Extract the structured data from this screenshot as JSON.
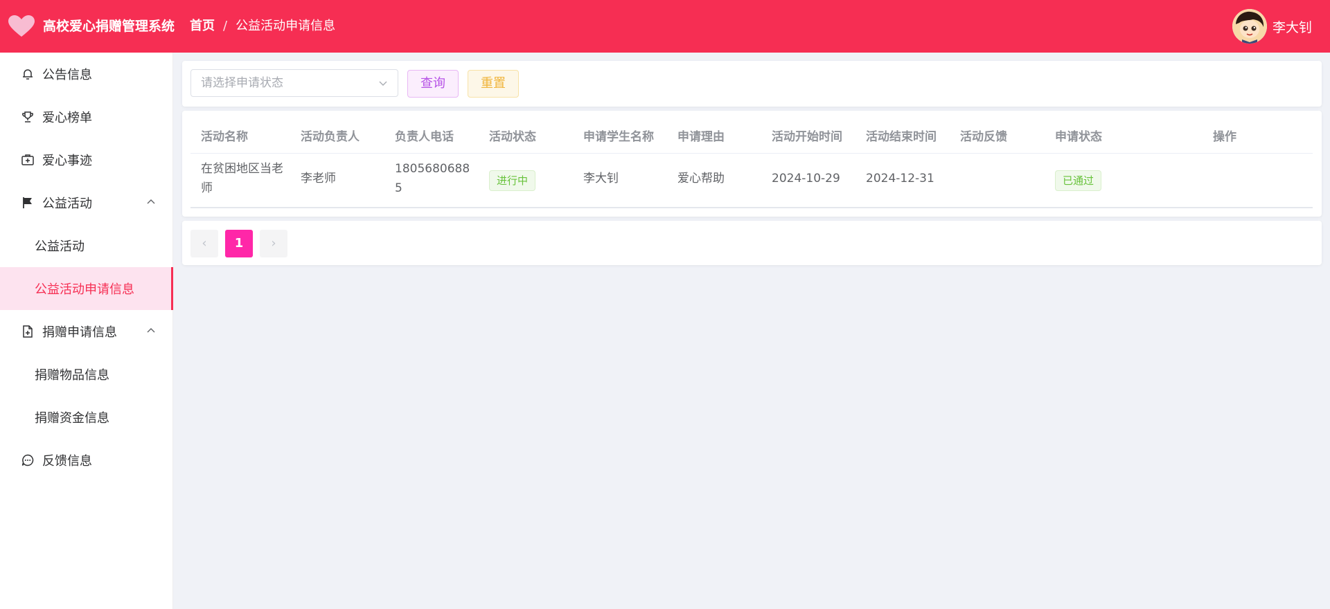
{
  "header": {
    "system_title": "高校爱心捐赠管理系统",
    "breadcrumb": [
      "首页",
      "/",
      "公益活动申请信息"
    ],
    "user_name": "李大钊",
    "brand_color": "#f62e53"
  },
  "sidebar": {
    "items": [
      {
        "label": "公告信息",
        "icon": "bell-icon"
      },
      {
        "label": "爱心榜单",
        "icon": "trophy-icon"
      },
      {
        "label": "爱心事迹",
        "icon": "first-aid-kit-icon"
      },
      {
        "label": "公益活动",
        "icon": "flag-icon",
        "expanded": true,
        "children": [
          {
            "label": "公益活动"
          },
          {
            "label": "公益活动申请信息",
            "active": true
          }
        ]
      },
      {
        "label": "捐赠申请信息",
        "icon": "document-add-icon",
        "expanded": true,
        "children": [
          {
            "label": "捐赠物品信息"
          },
          {
            "label": "捐赠资金信息"
          }
        ]
      },
      {
        "label": "反馈信息",
        "icon": "chat-dot-icon"
      }
    ]
  },
  "search": {
    "status_placeholder": "请选择申请状态",
    "query_label": "查询",
    "reset_label": "重置"
  },
  "table": {
    "columns": [
      "活动名称",
      "活动负责人",
      "负责人电话",
      "活动状态",
      "申请学生名称",
      "申请理由",
      "活动开始时间",
      "活动结束时间",
      "活动反馈",
      "申请状态",
      "操作"
    ],
    "rows": [
      {
        "activity_name": "在贫困地区当老师",
        "owner": "李老师",
        "phone": "18056806885",
        "activity_status": "进行中",
        "student": "李大钊",
        "reason": "爱心帮助",
        "start": "2024-10-29",
        "end": "2024-12-31",
        "feedback": "",
        "apply_status": "已通过"
      }
    ]
  },
  "pagination": {
    "current": "1",
    "prev_glyph": "‹",
    "next_glyph": "›"
  }
}
